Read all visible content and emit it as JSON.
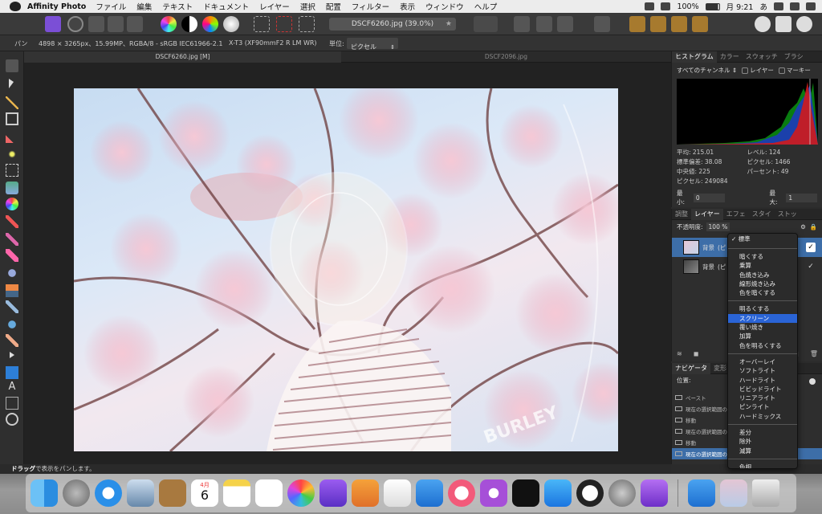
{
  "menubar": {
    "app_name": "Affinity Photo",
    "items": [
      "ファイル",
      "編集",
      "テキスト",
      "ドキュメント",
      "レイヤー",
      "選択",
      "配置",
      "フィルター",
      "表示",
      "ウィンドウ",
      "ヘルプ"
    ],
    "battery": "100%",
    "clock": "月 9:21",
    "input_method": "あ"
  },
  "toolbar": {
    "document_title": "DSCF6260.jpg (39.0%)"
  },
  "contextbar": {
    "tool_name": "パン",
    "image_info": "4898 × 3265px、15.99MP、RGBA/8 - sRGB IEC61966-2.1",
    "camera": "X-T3 (XF90mmF2 R LM WR)",
    "unit_label": "単位:",
    "unit_value": "ピクセル"
  },
  "doc_tabs": {
    "active": "DSCF6260.jpg [M]",
    "inactive": "DSCF2096.jpg"
  },
  "statusbar": {
    "bold": "ドラッグ",
    "text": "で表示をパンします。"
  },
  "histogram_panel": {
    "tabs": [
      "ヒストグラム",
      "カラー",
      "スウォッチ",
      "ブラシ"
    ],
    "channel": "すべてのチャンネル",
    "layer_option": "レイヤー",
    "marquee_option": "マーキー",
    "stats": [
      "平均: 215.01",
      "レベル: 124",
      "標準偏差: 38.08",
      "ピクセル: 1466",
      "中央値: 225",
      "パーセント: 49",
      "ピクセル: 249084",
      ""
    ],
    "min_label": "最小:",
    "min_value": "0",
    "max_label": "最大:",
    "max_value": "1"
  },
  "layers_panel": {
    "tabs": [
      "調整",
      "レイヤー",
      "エフェ",
      "スタイ",
      "ストッ"
    ],
    "opacity_label": "不透明度:",
    "opacity_value": "100 %",
    "layers": [
      {
        "name": "背景",
        "mode": "(ピ"
      },
      {
        "name": "背景",
        "mode": "(ピ"
      }
    ]
  },
  "navigator_panel": {
    "tabs": [
      "ナビゲータ",
      "変形"
    ],
    "position_label": "位置:"
  },
  "history": {
    "items": [
      "ペースト",
      "現在の選択範囲の状",
      "移動",
      "現在の選択範囲の状",
      "移動",
      "現在の選択範囲の状"
    ]
  },
  "blend_menu": {
    "current": "標準",
    "groups": [
      [
        "暗くする",
        "乗算",
        "色焼き込み",
        "線形焼き込み",
        "色を暗くする"
      ],
      [
        "明るくする",
        "スクリーン",
        "覆い焼き",
        "加算",
        "色を明るくする"
      ],
      [
        "オーバーレイ",
        "ソフトライト",
        "ハードライト",
        "ビビッドライト",
        "リニアライト",
        "ピンライト",
        "ハードミックス"
      ],
      [
        "差分",
        "除外",
        "減算"
      ],
      [
        "色相"
      ]
    ],
    "selected": "スクリーン"
  },
  "photo": {
    "watermark": "BURLEY"
  },
  "calendar": {
    "month": "4月",
    "day": "6"
  },
  "colors": {
    "accent": "#2a64d6",
    "selection": "#3d6ea8",
    "blossom": "#e7a9bd"
  }
}
